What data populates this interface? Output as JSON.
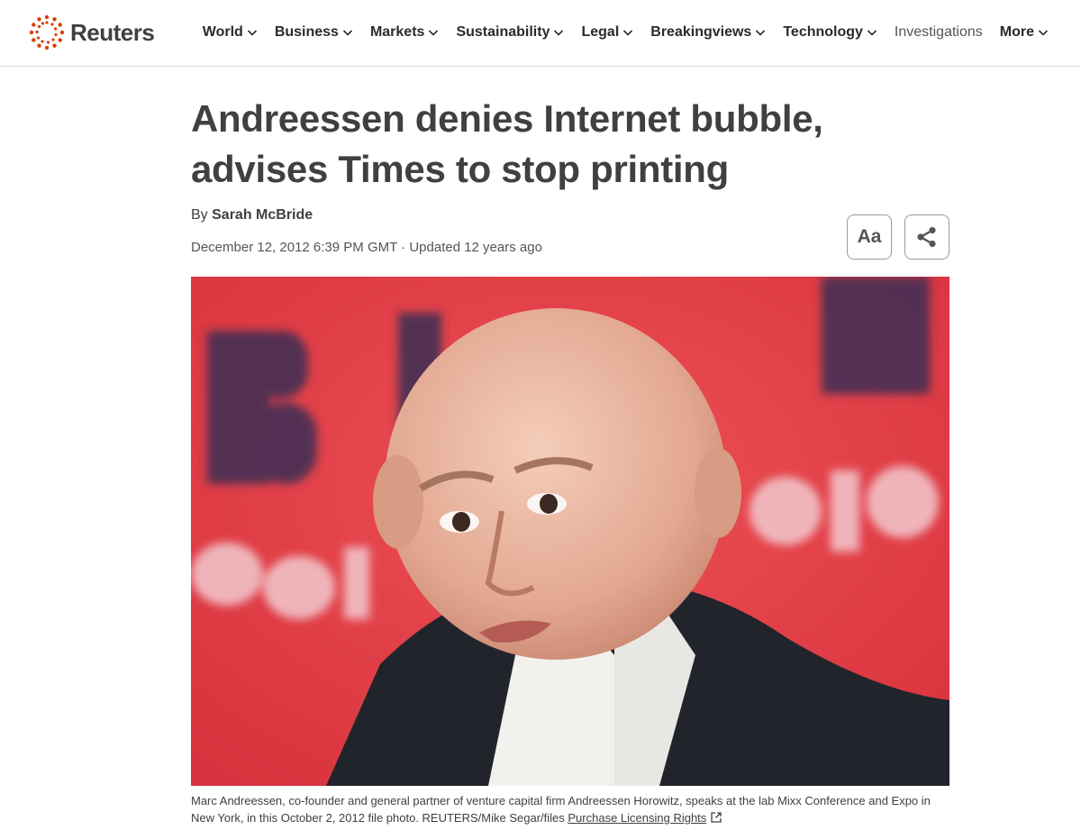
{
  "brand": {
    "name": "Reuters",
    "accent": "#d64000"
  },
  "nav": {
    "items": [
      {
        "label": "World",
        "dropdown": true
      },
      {
        "label": "Business",
        "dropdown": true
      },
      {
        "label": "Markets",
        "dropdown": true
      },
      {
        "label": "Sustainability",
        "dropdown": true
      },
      {
        "label": "Legal",
        "dropdown": true
      },
      {
        "label": "Breakingviews",
        "dropdown": true
      },
      {
        "label": "Technology",
        "dropdown": true
      },
      {
        "label": "Investigations",
        "dropdown": false
      },
      {
        "label": "More",
        "dropdown": true
      }
    ]
  },
  "article": {
    "headline": "Andreessen denies Internet bubble, advises Times to stop printing",
    "by_prefix": "By",
    "author": "Sarah McBride",
    "dateline": "December 12, 2012 6:39 PM GMT · Updated 12 years ago",
    "font_button_label": "Aa",
    "caption": "Marc Andreessen, co-founder and general partner of venture capital firm Andreessen Horowitz, speaks at the lab Mixx Conference and Expo in New York, in this October 2, 2012 file photo. REUTERS/Mike Segar/files",
    "licensing_link": "Purchase Licensing Rights"
  },
  "icons": {
    "logo": "reuters-dot-ring-icon",
    "dropdown": "chevron-down-icon",
    "share": "share-icon",
    "external": "external-link-icon"
  },
  "colors": {
    "text": "#404040",
    "photo_background": "#e4434b"
  }
}
